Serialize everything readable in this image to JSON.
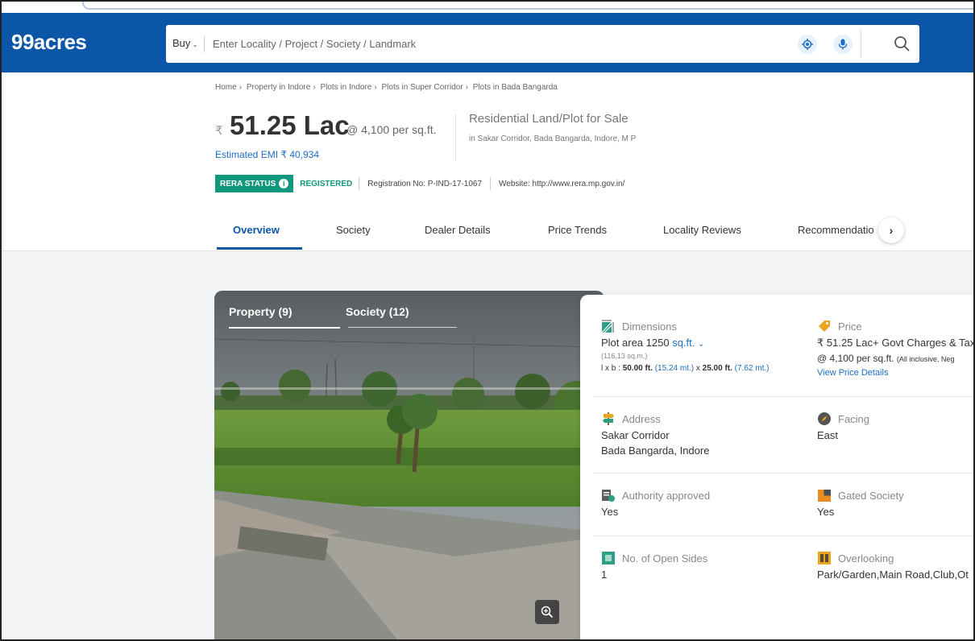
{
  "header": {
    "logo": "99acres",
    "buy_label": "Buy",
    "search_placeholder": "Enter Locality / Project / Society / Landmark"
  },
  "breadcrumb": [
    "Home",
    "Property in Indore",
    "Plots in Indore",
    "Plots in Super Corridor",
    "Plots in Bada Bangarda"
  ],
  "summary": {
    "currency_symbol": "₹",
    "price": "51.25 Lac",
    "price_per": "@ 4,100 per sq.ft.",
    "emi": "Estimated EMI ₹ 40,934",
    "property_type": "Residential Land/Plot for Sale",
    "location": "in Sakar Corridor, Bada Bangarda, Indore, M P"
  },
  "rera": {
    "status_label": "RERA STATUS",
    "status_value": "REGISTERED",
    "registration": "Registration No: P-IND-17-1067",
    "website": "Website: http://www.rera.mp.gov.in/"
  },
  "tabs": [
    "Overview",
    "Society",
    "Dealer Details",
    "Price Trends",
    "Locality Reviews",
    "Recommendatio"
  ],
  "gallery": {
    "tab_property": "Property (9)",
    "tab_society": "Society (12)"
  },
  "details": {
    "dimensions": {
      "label": "Dimensions",
      "value": "Plot area 1250",
      "unit": "sq.ft.",
      "sqm": "(116.13 sq.m.)",
      "lxb_prefix": "l x b : ",
      "length_ft": "50.00 ft.",
      "length_m": "(15.24 mt.)",
      "by": " x ",
      "breadth_ft": "25.00 ft.",
      "breadth_m": "(7.62 mt.)"
    },
    "price": {
      "label": "Price",
      "value": "₹ 51.25 Lac+ Govt Charges & Tax",
      "per": "@ 4,100 per sq.ft.",
      "per_note": "(All inclusive, Neg",
      "link": "View Price Details"
    },
    "address": {
      "label": "Address",
      "line1": "Sakar Corridor",
      "line2": "Bada Bangarda, Indore"
    },
    "facing": {
      "label": "Facing",
      "value": "East"
    },
    "authority": {
      "label": "Authority approved",
      "value": "Yes"
    },
    "gated": {
      "label": "Gated Society",
      "value": "Yes"
    },
    "open_sides": {
      "label": "No. of Open Sides",
      "value": "1"
    },
    "overlooking": {
      "label": "Overlooking",
      "value": "Park/Garden,Main Road,Club,Ot"
    }
  },
  "colors": {
    "brand_blue": "#0c56a7",
    "rera_green": "#10977d",
    "link_blue": "#1c6ec4"
  },
  "icons": [
    "search-icon",
    "location-target-icon",
    "microphone-icon",
    "info-icon",
    "chevron-right-icon",
    "zoom-in-icon",
    "dimensions-icon",
    "price-tag-icon",
    "signpost-icon",
    "compass-icon",
    "authority-icon",
    "gated-icon",
    "open-sides-icon",
    "overlooking-icon"
  ]
}
